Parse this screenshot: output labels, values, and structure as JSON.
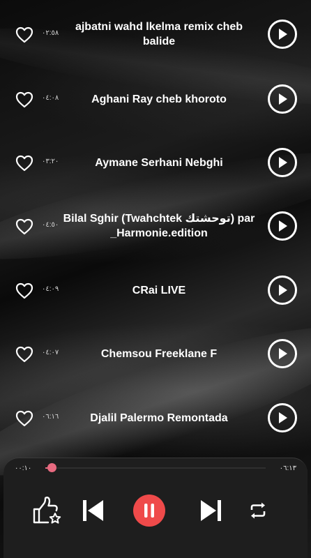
{
  "songs": [
    {
      "title": "ajbatni wahd lkelma remix cheb balide",
      "duration": "٠٢:٥٨"
    },
    {
      "title": "Aghani Ray  cheb khoroto",
      "duration": "٠٤:٠٨"
    },
    {
      "title": "Aymane Serhani  Nebghi",
      "duration": "٠٣:٢٠"
    },
    {
      "title": "Bilal Sghir (Twahchtek توحشتك) par _Harmonie.edition",
      "duration": "٠٤:٥٠"
    },
    {
      "title": "CRai  LIVE",
      "duration": "٠٤:٠٩"
    },
    {
      "title": "Chemsou Freeklane F",
      "duration": "٠٤:٠٧"
    },
    {
      "title": "Djalil Palermo  Remontada",
      "duration": "٠٦:١٦"
    }
  ],
  "player": {
    "time_elapsed": "٠٠:١٠",
    "time_total": "٠٦:١٣",
    "progress": 0.03,
    "accent_color": "#e86a80",
    "pause_color": "#ef4a4a",
    "controls": [
      "thumbs-up-star-icon",
      "skip-previous-icon",
      "pause-icon",
      "skip-next-icon",
      "repeat-icon"
    ]
  }
}
